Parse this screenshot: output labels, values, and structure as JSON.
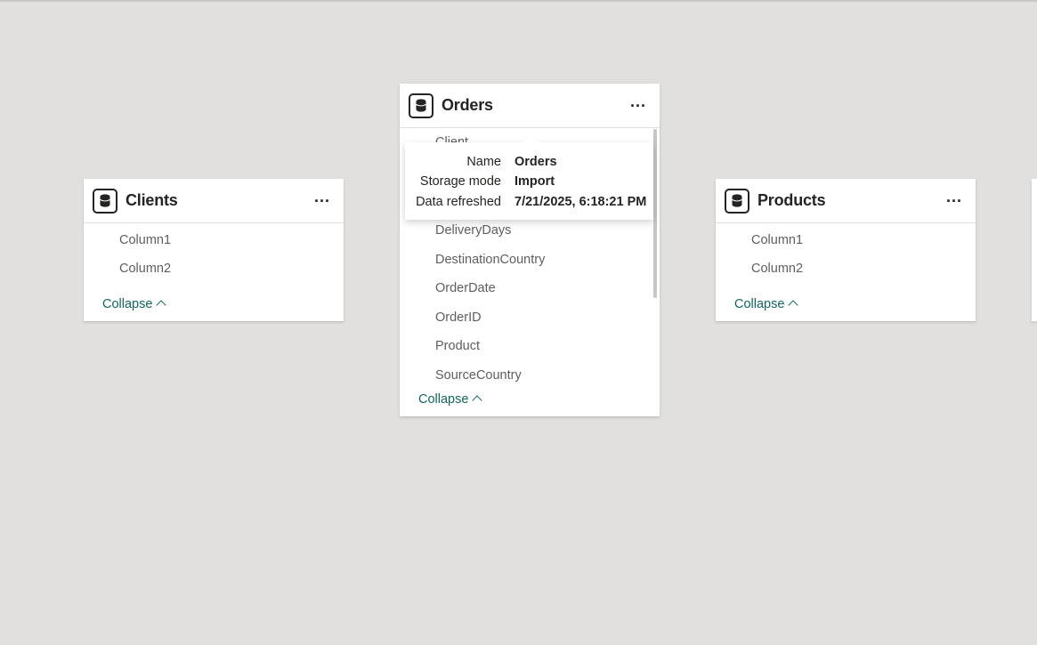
{
  "tables": {
    "clients": {
      "title": "Clients",
      "more_label": "...",
      "columns": [
        "Column1",
        "Column2"
      ],
      "collapse_label": "Collapse"
    },
    "orders": {
      "title": "Orders",
      "more_label": "...",
      "partial_column": "Client",
      "columns": [
        "DeliveryDays",
        "DestinationCountry",
        "OrderDate",
        "OrderID",
        "Product",
        "SourceCountry"
      ],
      "collapse_label": "Collapse"
    },
    "products": {
      "title": "Products",
      "more_label": "...",
      "columns": [
        "Column1",
        "Column2"
      ],
      "collapse_label": "Collapse"
    }
  },
  "tooltip": {
    "rows": [
      {
        "label": "Name",
        "value": "Orders"
      },
      {
        "label": "Storage mode",
        "value": "Import"
      },
      {
        "label": "Data refreshed",
        "value": "7/21/2025, 6:18:21 PM"
      }
    ]
  },
  "icons": {
    "table": "database-icon",
    "more": "more-options-icon",
    "collapse": "chevron-up-icon"
  },
  "colors": {
    "canvas": "#e1e0df",
    "card": "#ffffff",
    "accent_link": "#116761",
    "text_primary": "#252423",
    "text_secondary": "#605e5c"
  }
}
